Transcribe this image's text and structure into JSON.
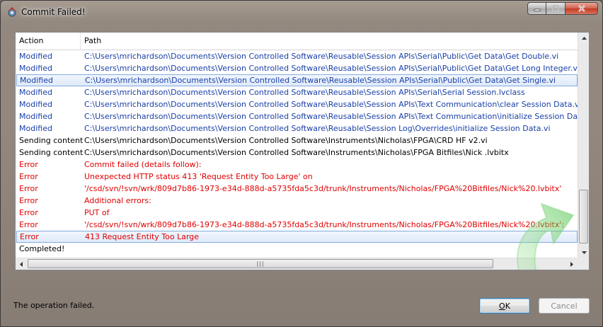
{
  "window": {
    "title": "Commit Failed!",
    "controls": {
      "minimize": "minimize",
      "maximize": "maximize",
      "close": "close"
    }
  },
  "list": {
    "columns": {
      "action": "Action",
      "path": "Path"
    },
    "rows": [
      {
        "action": "Modified",
        "path": "C:\\Users\\mrichardson\\Documents\\Version Controlled Software\\Reusable\\Session APIs\\Serial\\Public\\Get Data\\Get Double.vi",
        "kind": "blue"
      },
      {
        "action": "Modified",
        "path": "C:\\Users\\mrichardson\\Documents\\Version Controlled Software\\Reusable\\Session APIs\\Serial\\Public\\Get Data\\Get Long Integer.vi",
        "kind": "blue"
      },
      {
        "action": "Modified",
        "path": "C:\\Users\\mrichardson\\Documents\\Version Controlled Software\\Reusable\\Session APIs\\Serial\\Public\\Get Data\\Get Single.vi",
        "kind": "blue",
        "selected": true
      },
      {
        "action": "Modified",
        "path": "C:\\Users\\mrichardson\\Documents\\Version Controlled Software\\Reusable\\Session APIs\\Serial\\Serial Session.lvclass",
        "kind": "blue"
      },
      {
        "action": "Modified",
        "path": "C:\\Users\\mrichardson\\Documents\\Version Controlled Software\\Reusable\\Session APIs\\Text Communication\\clear Session Data.vi",
        "kind": "blue"
      },
      {
        "action": "Modified",
        "path": "C:\\Users\\mrichardson\\Documents\\Version Controlled Software\\Reusable\\Session APIs\\Text Communication\\initialize Session Data.vi",
        "kind": "blue"
      },
      {
        "action": "Modified",
        "path": "C:\\Users\\mrichardson\\Documents\\Version Controlled Software\\Reusable\\Session Log\\Overrides\\initialize Session Data.vi",
        "kind": "blue"
      },
      {
        "action": "Sending content",
        "path": "C:\\Users\\mrichardson\\Documents\\Version Controlled Software\\Instruments\\Nicholas\\FPGA\\CRD HF v2.vi",
        "kind": "black"
      },
      {
        "action": "Sending content",
        "path": "C:\\Users\\mrichardson\\Documents\\Version Controlled Software\\Instruments\\Nicholas\\FPGA Bitfiles\\Nick .lvbitx",
        "kind": "black"
      },
      {
        "action": "Error",
        "path": "Commit failed (details follow):",
        "kind": "red"
      },
      {
        "action": "Error",
        "path": "Unexpected HTTP status 413 'Request Entity Too Large' on",
        "kind": "red"
      },
      {
        "action": "Error",
        "path": " '/csd/svn/!svn/wrk/809d7b86-1973-e34d-888d-a5735fda5c3d/trunk/Instruments/Nicholas/FPGA%20Bitfiles/Nick%20.lvbitx'",
        "kind": "red"
      },
      {
        "action": "Error",
        "path": "Additional errors:",
        "kind": "red"
      },
      {
        "action": "Error",
        "path": "PUT of",
        "kind": "red"
      },
      {
        "action": "Error",
        "path": " '/csd/svn/!svn/wrk/809d7b86-1973-e34d-888d-a5735fda5c3d/trunk/Instruments/Nicholas/FPGA%20Bitfiles/Nick%20.lvbitx':",
        "kind": "red"
      },
      {
        "action": "Error",
        "path": " 413 Request Entity Too Large",
        "kind": "red",
        "selected": true
      },
      {
        "action": "Completed!",
        "path": "",
        "kind": "black"
      }
    ]
  },
  "status": {
    "text": "The operation failed."
  },
  "buttons": {
    "ok_prefix": "",
    "ok_underlined": "O",
    "ok_rest": "K",
    "cancel": "Cancel"
  },
  "colors": {
    "modified": "#1a40a8",
    "error": "#e00000",
    "normal": "#000000",
    "selection": "#dfeaf9"
  }
}
